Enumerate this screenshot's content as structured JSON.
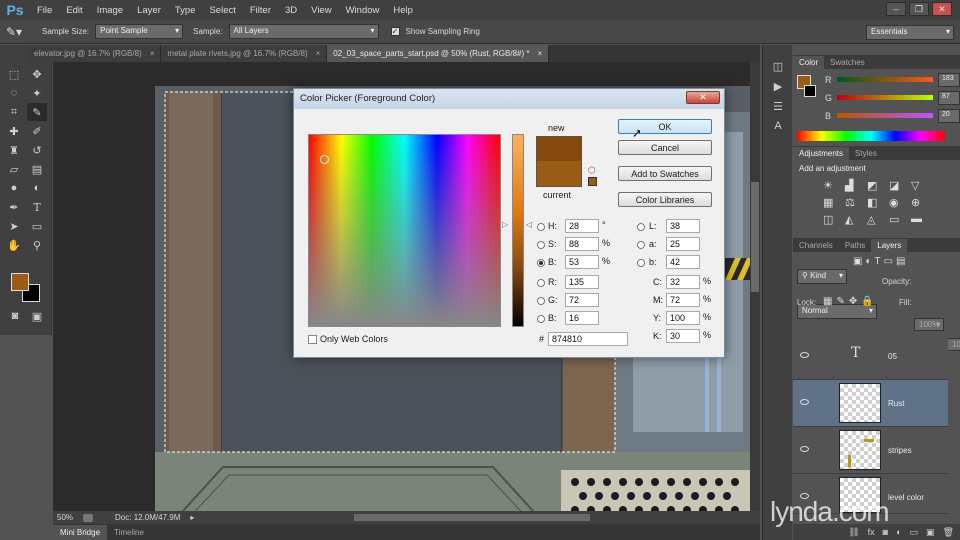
{
  "app": {
    "logo": "Ps",
    "menu": [
      "File",
      "Edit",
      "Image",
      "Layer",
      "Type",
      "Select",
      "Filter",
      "3D",
      "View",
      "Window",
      "Help"
    ],
    "window_controls": [
      "–",
      "❐",
      "✕"
    ]
  },
  "options_bar": {
    "sample_size_label": "Sample Size:",
    "sample_size_value": "Point Sample",
    "sample_label": "Sample:",
    "sample_value": "All Layers",
    "show_ring_label": "Show Sampling Ring",
    "show_ring_checked": true,
    "workspace": "Essentials"
  },
  "doc_tabs": [
    {
      "label": "elevator.jpg @ 16.7% (RGB/8)",
      "close": "×",
      "active": false
    },
    {
      "label": "metal plate rivets.jpg @ 16.7% (RGB/8)",
      "close": "×",
      "active": false
    },
    {
      "label": "02_03_space_parts_start.psd @ 50% (Rust, RGB/8#) *",
      "close": "×",
      "active": true
    }
  ],
  "color_picker": {
    "title": "Color Picker (Foreground Color)",
    "close": "✕",
    "new_label": "new",
    "current_label": "current",
    "new_color": "#874810",
    "current_color": "#9a5c14",
    "buttons": {
      "ok": "OK",
      "cancel": "Cancel",
      "add_swatches": "Add to Swatches",
      "libraries": "Color Libraries"
    },
    "only_web_colors": "Only Web Colors",
    "hsb": {
      "h_label": "H:",
      "h": "28",
      "h_unit": "°",
      "s_label": "S:",
      "s": "88",
      "s_unit": "%",
      "b_label": "B:",
      "b": "53",
      "b_unit": "%"
    },
    "rgb": {
      "r_label": "R:",
      "r": "135",
      "g_label": "G:",
      "g": "72",
      "b_label": "B:",
      "b": "16"
    },
    "lab": {
      "l_label": "L:",
      "l": "38",
      "a_label": "a:",
      "a": "25",
      "b_label": "b:",
      "b": "42"
    },
    "cmyk": {
      "c_label": "C:",
      "c": "32",
      "c_unit": "%",
      "m_label": "M:",
      "m": "72",
      "m_unit": "%",
      "y_label": "Y:",
      "y": "100",
      "y_unit": "%",
      "k_label": "K:",
      "k": "30",
      "k_unit": "%"
    },
    "hex_label": "#",
    "hex": "874810"
  },
  "color_panel": {
    "tabs": [
      "Color",
      "Swatches"
    ],
    "r_label": "R",
    "r": "183",
    "g_label": "G",
    "g": "87",
    "b_label": "B",
    "b": "20"
  },
  "adjustments_panel": {
    "tabs": [
      "Adjustments",
      "Styles"
    ],
    "heading": "Add an adjustment"
  },
  "layers_panel": {
    "tabs": [
      "Channels",
      "Paths",
      "Layers"
    ],
    "kind": "Kind",
    "blend_mode": "Normal",
    "opacity_label": "Opacity:",
    "opacity": "100%",
    "lock_label": "Lock:",
    "fill_label": "Fill:",
    "fill": "100%",
    "layers": [
      {
        "name": "05",
        "type": "text",
        "selected": false
      },
      {
        "name": "Rust",
        "type": "pixel",
        "selected": true
      },
      {
        "name": "stripes",
        "type": "pixel",
        "selected": false
      },
      {
        "name": "level color",
        "type": "pixel",
        "selected": false
      }
    ]
  },
  "status": {
    "zoom": "50%",
    "doc": "Doc: 12.0M/47.9M"
  },
  "bottom_tabs": [
    "Mini Bridge",
    "Timeline"
  ],
  "watermark": "lynda.com",
  "colors": {
    "foreground": "#9a5c14",
    "background": "#000000",
    "accent": "#5fb0e8"
  }
}
